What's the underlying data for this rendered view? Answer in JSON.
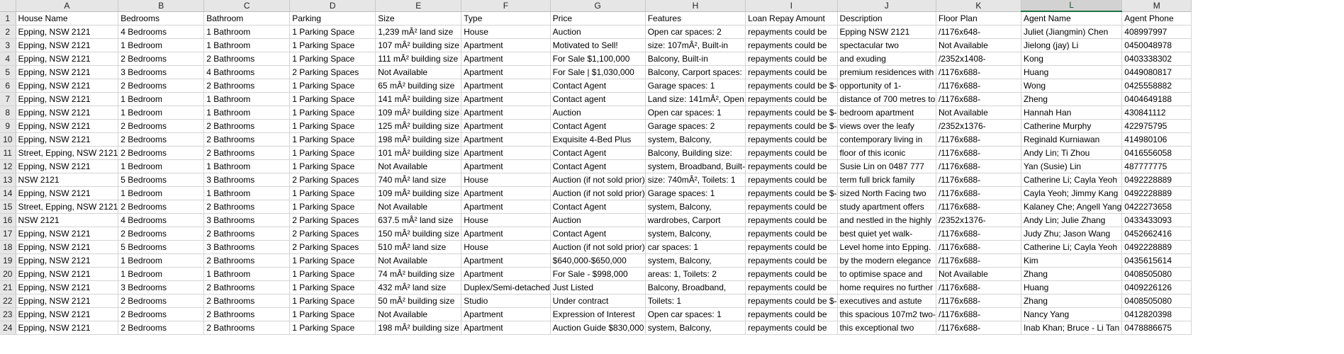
{
  "columns": [
    "A",
    "B",
    "C",
    "D",
    "E",
    "F",
    "G",
    "H",
    "I",
    "J",
    "K",
    "L",
    "M"
  ],
  "rows": [
    [
      "House Name",
      "Bedrooms",
      "Bathroom",
      "Parking",
      "Size",
      "Type",
      "Price",
      "Features",
      "Loan Repay Amount",
      "Description",
      "Floor Plan",
      "Agent Name",
      "Agent Phone"
    ],
    [
      "Epping, NSW 2121",
      "4 Bedrooms",
      "1 Bathroom",
      "1 Parking Space",
      "1,239 mÂ² land size",
      "House",
      "Auction",
      "Open car spaces: 2",
      "repayments could be",
      "Epping NSW 2121",
      "/1176x648-",
      "Juliet (Jiangmin) Chen",
      "408997997"
    ],
    [
      "Epping, NSW 2121",
      "1 Bedroom",
      "1 Bathroom",
      "1 Parking Space",
      "107 mÂ² building size",
      "Apartment",
      "Motivated to Sell!",
      "size: 107mÂ², Built-in",
      "repayments could be",
      "spectacular two",
      "Not Available",
      "Jielong (jay) Li",
      "0450048978"
    ],
    [
      "Epping, NSW 2121",
      "2 Bedrooms",
      "2 Bathrooms",
      "1 Parking Space",
      "111 mÂ² building size",
      "Apartment",
      "For Sale $1,100,000",
      "Balcony, Built-in",
      "repayments could be",
      "and exuding",
      "/2352x1408-",
      "Kong",
      "0403338302"
    ],
    [
      "Epping, NSW 2121",
      "3 Bedrooms",
      "4 Bathrooms",
      "2 Parking Spaces",
      "Not Available",
      "Apartment",
      "For Sale | $1,030,000",
      "Balcony, Carport spaces:",
      "repayments could be",
      "premium residences with",
      "/1176x688-",
      "Huang",
      "0449080817"
    ],
    [
      "Epping, NSW 2121",
      "2 Bedrooms",
      "2 Bathrooms",
      "1 Parking Space",
      "65 mÂ² building size",
      "Apartment",
      "Contact Agent",
      "Garage spaces: 1",
      "repayments could be $-",
      "opportunity of 1-",
      "/1176x688-",
      "Wong",
      "0425558882"
    ],
    [
      "Epping, NSW 2121",
      "1 Bedroom",
      "1 Bathroom",
      "1 Parking Space",
      "141 mÂ² building size",
      "Apartment",
      "Contact agent",
      "Land size: 141mÂ², Open",
      "repayments could be",
      "distance of 700 metres to",
      "/1176x688-",
      "Zheng",
      "0404649188"
    ],
    [
      "Epping, NSW 2121",
      "1 Bedroom",
      "1 Bathroom",
      "1 Parking Space",
      "109 mÂ² building size",
      "Apartment",
      "Auction",
      "Open car spaces: 1",
      "repayments could be $-",
      "bedroom apartment",
      "Not Available",
      "Hannah Han",
      "430841112"
    ],
    [
      "Epping, NSW 2121",
      "2 Bedrooms",
      "2 Bathrooms",
      "1 Parking Space",
      "125 mÂ² building size",
      "Apartment",
      "Contact Agent",
      "Garage spaces: 2",
      "repayments could be $-",
      "views over the leafy",
      "/2352x1376-",
      "Catherine Murphy",
      "422975795"
    ],
    [
      "Epping, NSW 2121",
      "2 Bedrooms",
      "2 Bathrooms",
      "1 Parking Space",
      "198 mÂ² building size",
      "Apartment",
      "Exquisite 4-Bed Plus",
      "system, Balcony,",
      "repayments could be",
      "contemporary living in",
      "/1176x688-",
      "Reginald Kurniawan",
      "414980106"
    ],
    [
      "Street, Epping, NSW 2121",
      "2 Bedrooms",
      "2 Bathrooms",
      "1 Parking Space",
      "101 mÂ² building size",
      "Apartment",
      "Contact Agent",
      "Balcony, Building size:",
      "repayments could be",
      "floor of this iconic",
      "/1176x688-",
      "Andy Lin; Ti Zhou",
      "0416556058"
    ],
    [
      "Epping, NSW 2121",
      "1 Bedroom",
      "1 Bathroom",
      "1 Parking Space",
      "Not Available",
      "Apartment",
      "Contact Agent",
      "system, Broadband, Built-",
      "repayments could be",
      "Susie Lin on 0487 777",
      "/1176x688-",
      "Yan (Susie) Lin",
      "487777775"
    ],
    [
      "NSW 2121",
      "5 Bedrooms",
      "3 Bathrooms",
      "2 Parking Spaces",
      "740 mÂ² land size",
      "House",
      "Auction (if not sold prior)",
      "size: 740mÂ², Toilets: 1",
      "repayments could be",
      "term full brick family",
      "/1176x688-",
      "Catherine Li; Cayla Yeoh",
      "0492228889"
    ],
    [
      "Epping, NSW 2121",
      "1 Bedroom",
      "1 Bathroom",
      "1 Parking Space",
      "109 mÂ² building size",
      "Apartment",
      "Auction (if not sold prior)",
      "Garage spaces: 1",
      "repayments could be $-",
      "sized North Facing two",
      "/1176x688-",
      "Cayla Yeoh; Jimmy Kang",
      "0492228889"
    ],
    [
      "Street, Epping, NSW 2121",
      "2 Bedrooms",
      "2 Bathrooms",
      "1 Parking Space",
      "Not Available",
      "Apartment",
      "Contact Agent",
      "system, Balcony,",
      "repayments could be",
      "study apartment offers",
      "/1176x688-",
      "Kalaney Che; Angell Yang",
      "0422273658"
    ],
    [
      "NSW 2121",
      "4 Bedrooms",
      "3 Bathrooms",
      "2 Parking Spaces",
      "637.5 mÂ² land size",
      "House",
      "Auction",
      "wardrobes, Carport",
      "repayments could be",
      "and nestled in the highly",
      "/2352x1376-",
      "Andy Lin; Julie Zhang",
      "0433433093"
    ],
    [
      "Epping, NSW 2121",
      "2 Bedrooms",
      "2 Bathrooms",
      "2 Parking Spaces",
      "150 mÂ² building size",
      "Apartment",
      "Contact Agent",
      "system, Balcony,",
      "repayments could be",
      "best quiet yet walk-",
      "/1176x688-",
      "Judy Zhu; Jason Wang",
      "0452662416"
    ],
    [
      "Epping, NSW 2121",
      "5 Bedrooms",
      "3 Bathrooms",
      "2 Parking Spaces",
      "510 mÂ² land size",
      "House",
      "Auction (if not sold prior)",
      "car spaces: 1",
      "repayments could be",
      "Level home into Epping.",
      "/1176x688-",
      "Catherine Li; Cayla Yeoh",
      "0492228889"
    ],
    [
      "Epping, NSW 2121",
      "1 Bedroom",
      "2 Bathrooms",
      "1 Parking Space",
      "Not Available",
      "Apartment",
      "$640,000-$650,000",
      "system, Balcony,",
      "repayments could be",
      "by the modern elegance",
      "/1176x688-",
      "Kim",
      "0435615614"
    ],
    [
      "Epping, NSW 2121",
      "1 Bedroom",
      "1 Bathroom",
      "1 Parking Space",
      "74 mÂ² building size",
      "Apartment",
      "For Sale - $998,000",
      "areas: 1, Toilets: 2",
      "repayments could be",
      "to optimise space and",
      "Not Available",
      "Zhang",
      "0408505080"
    ],
    [
      "Epping, NSW 2121",
      "3 Bedrooms",
      "2 Bathrooms",
      "1 Parking Space",
      "432 mÂ² land size",
      "Duplex/Semi-detached",
      "Just Listed",
      "Balcony, Broadband,",
      "repayments could be",
      "home requires no further",
      "/1176x688-",
      "Huang",
      "0409226126"
    ],
    [
      "Epping, NSW 2121",
      "2 Bedrooms",
      "2 Bathrooms",
      "1 Parking Space",
      "50 mÂ² building size",
      "Studio",
      "Under contract",
      "Toilets: 1",
      "repayments could be $-",
      "executives and astute",
      "/1176x688-",
      "Zhang",
      "0408505080"
    ],
    [
      "Epping, NSW 2121",
      "2 Bedrooms",
      "2 Bathrooms",
      "1 Parking Space",
      "Not Available",
      "Apartment",
      "Expression of Interest",
      "Open car spaces: 1",
      "repayments could be",
      "this spacious 107m2 two-",
      "/1176x688-",
      "Nancy Yang",
      "0412820398"
    ],
    [
      "Epping, NSW 2121",
      "2 Bedrooms",
      "2 Bathrooms",
      "1 Parking Space",
      "198 mÂ² building size",
      "Apartment",
      "Auction Guide $830,000",
      "system, Balcony,",
      "repayments could be",
      "this exceptional two",
      "/1176x688-",
      "Inab Khan; Bruce - Li Tan",
      "0478886675"
    ]
  ],
  "selected_column": "L"
}
